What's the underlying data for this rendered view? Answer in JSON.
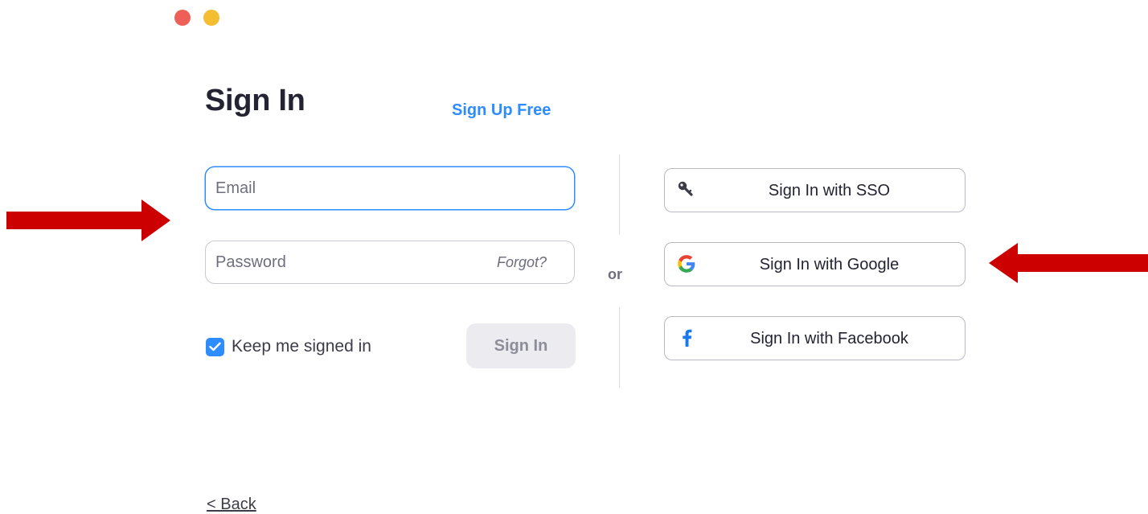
{
  "window": {
    "controls": [
      "close",
      "minimize"
    ]
  },
  "header": {
    "title": "Sign In",
    "signup_link": "Sign Up Free"
  },
  "form": {
    "email_placeholder": "Email",
    "password_placeholder": "Password",
    "forgot_label": "Forgot?",
    "keep_signed_in_label": "Keep me signed in",
    "keep_signed_in_checked": true,
    "submit_label": "Sign In"
  },
  "divider": {
    "or_label": "or"
  },
  "alt_signin": {
    "sso_label": "Sign In with SSO",
    "google_label": "Sign In with Google",
    "facebook_label": "Sign In with Facebook",
    "sso_icon": "key-icon",
    "google_icon": "google-logo-icon",
    "facebook_icon": "facebook-logo-icon"
  },
  "footer": {
    "back_label": "< Back"
  },
  "colors": {
    "accent": "#2d8cff",
    "annotation_arrow": "#cc0000",
    "close_dot": "#ed5f57",
    "minimize_dot": "#f4bd32"
  },
  "annotations": {
    "arrows": [
      "right-pointing-arrow",
      "left-pointing-arrow"
    ]
  }
}
